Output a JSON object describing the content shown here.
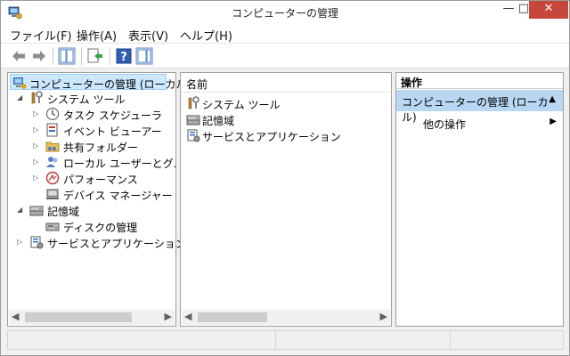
{
  "window": {
    "title": "コンピューターの管理",
    "controls": {
      "minimize": "—",
      "maximize": "□",
      "close": "✕"
    }
  },
  "menu": {
    "items": [
      {
        "label": "ファイル(F)"
      },
      {
        "label": "操作(A)"
      },
      {
        "label": "表示(V)"
      },
      {
        "label": "ヘルプ(H)"
      }
    ]
  },
  "toolbar": {
    "buttons": [
      {
        "name": "back-icon"
      },
      {
        "name": "forward-icon"
      },
      {
        "name": "show-console-tree-icon"
      },
      {
        "name": "export-list-icon"
      },
      {
        "name": "help-icon"
      },
      {
        "name": "show-action-pane-icon"
      }
    ]
  },
  "tree": {
    "root": "コンピューターの管理 (ローカル)",
    "items": [
      {
        "label": "システム ツール",
        "level": 1,
        "expanded": true
      },
      {
        "label": "タスク スケジューラ",
        "level": 2,
        "expandable": true
      },
      {
        "label": "イベント ビューアー",
        "level": 2,
        "expandable": true
      },
      {
        "label": "共有フォルダー",
        "level": 2,
        "expandable": true
      },
      {
        "label": "ローカル ユーザーとグループ",
        "level": 2,
        "expandable": true
      },
      {
        "label": "パフォーマンス",
        "level": 2,
        "expandable": true
      },
      {
        "label": "デバイス マネージャー",
        "level": 2,
        "expandable": false
      },
      {
        "label": "記憶域",
        "level": 1,
        "expanded": true
      },
      {
        "label": "ディスクの管理",
        "level": 2,
        "expandable": false
      },
      {
        "label": "サービスとアプリケーション",
        "level": 1,
        "expandable": true
      }
    ]
  },
  "list": {
    "header": "名前",
    "items": [
      {
        "label": "システム ツール"
      },
      {
        "label": "記憶域"
      },
      {
        "label": "サービスとアプリケーション"
      }
    ]
  },
  "actions": {
    "header": "操作",
    "group": "コンピューターの管理 (ローカル)",
    "more": "他の操作"
  }
}
